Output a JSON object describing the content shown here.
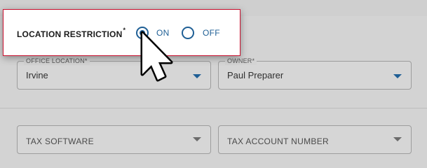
{
  "popup": {
    "title": "LOCATION RESTRICTION",
    "required_mark": "*",
    "options": [
      {
        "label": "ON",
        "selected": true
      },
      {
        "label": "OFF",
        "selected": false
      }
    ]
  },
  "form": {
    "office_location": {
      "label": "OFFICE LOCATION",
      "required_mark": "*",
      "value": "Irvine"
    },
    "owner": {
      "label": "OWNER",
      "required_mark": "*",
      "value": "Paul Preparer"
    },
    "tax_software": {
      "label": "TAX SOFTWARE"
    },
    "tax_account_number": {
      "label": "TAX ACCOUNT NUMBER"
    }
  },
  "colors": {
    "accent": "#1f5f95",
    "popup_border": "#c8102e",
    "overlay": "#d3d3d3"
  },
  "icons": {
    "cursor": "pointer-arrow-icon",
    "dropdown": "chevron-down-icon"
  }
}
